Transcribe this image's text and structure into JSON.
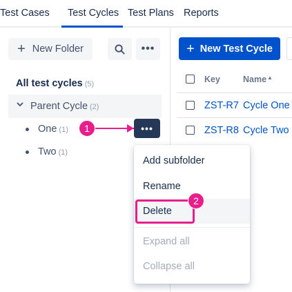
{
  "tabs": [
    {
      "label": "Test Cases",
      "active": false
    },
    {
      "label": "Test Cycles",
      "active": true
    },
    {
      "label": "Test Plans",
      "active": false
    },
    {
      "label": "Reports",
      "active": false
    }
  ],
  "sidebar": {
    "new_folder_label": "New Folder",
    "all_cycles_label": "All test cycles",
    "all_cycles_count": "(5)",
    "parent": {
      "label": "Parent Cycle",
      "count": "(2)"
    },
    "children": [
      {
        "label": "One",
        "count": "(1)"
      },
      {
        "label": "Two",
        "count": "(1)"
      }
    ],
    "more_label": "•••"
  },
  "main": {
    "new_cycle_label": "New Test Cycle",
    "columns": {
      "key": "Key",
      "name": "Name"
    },
    "rows": [
      {
        "key": "ZST-R7",
        "name": "Cycle One"
      },
      {
        "key": "ZST-R8",
        "name": "Cycle Two"
      }
    ]
  },
  "context_menu": {
    "items": [
      {
        "label": "Add subfolder",
        "disabled": false
      },
      {
        "label": "Rename",
        "disabled": false
      },
      {
        "label": "Delete",
        "disabled": false
      },
      {
        "label": "Expand all",
        "disabled": true
      },
      {
        "label": "Collapse all",
        "disabled": true
      }
    ]
  },
  "callouts": [
    "1",
    "2"
  ],
  "colors": {
    "accent": "#0052cc",
    "annotation": "#e91e8c",
    "dark_button": "#253858"
  }
}
